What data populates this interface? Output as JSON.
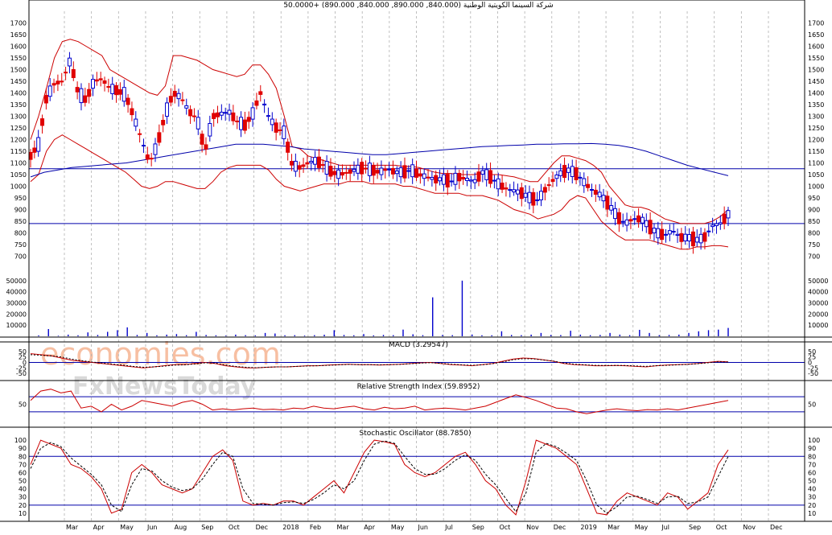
{
  "header": {
    "title": "شركة السينما الكويتية الوطنية (840.000, 890.000, 840.000, 890.000) +50.0000"
  },
  "watermark": {
    "line1": "economies.com",
    "line2": "FxNewsToday"
  },
  "colors": {
    "up_candle": "#0000cc",
    "down_candle": "#e00000",
    "bollinger": "#cc0000",
    "ma_long": "#0000aa",
    "hline": "#0000aa",
    "volume": "#0000cc",
    "macd": "#cc0000",
    "signal": "#000000",
    "rsi": "#cc0000",
    "stoch_k": "#cc0000",
    "stoch_d": "#000000",
    "grid": "#b0b0b0"
  },
  "x_axis": {
    "labels": [
      "Mar",
      "Apr",
      "May",
      "Jun",
      "Aug",
      "Sep",
      "Oct",
      "Dec",
      "2018",
      "Feb",
      "Mar",
      "Apr",
      "May",
      "Jun",
      "Jul",
      "Sep",
      "Oct",
      "Nov",
      "Dec",
      "2019",
      "Mar",
      "May",
      "Jul",
      "Sep",
      "Oct",
      "Nov",
      "Dec"
    ]
  },
  "chart_data": [
    {
      "type": "candlestick",
      "panel": "price",
      "title": "شركة السينما الكويتية الوطنية (840.000, 890.000, 840.000, 890.000) +50.0000",
      "ylim": [
        650,
        1750
      ],
      "yticks": [
        700,
        750,
        800,
        850,
        900,
        950,
        1000,
        1050,
        1100,
        1150,
        1200,
        1250,
        1300,
        1350,
        1400,
        1450,
        1500,
        1550,
        1600,
        1650,
        1700
      ],
      "horizontal_lines": [
        1075,
        840
      ],
      "price_path": [
        1130,
        1180,
        1380,
        1440,
        1450,
        1540,
        1400,
        1370,
        1450,
        1460,
        1420,
        1410,
        1390,
        1300,
        1200,
        1100,
        1180,
        1310,
        1400,
        1380,
        1320,
        1290,
        1150,
        1300,
        1310,
        1320,
        1280,
        1260,
        1310,
        1400,
        1300,
        1250,
        1230,
        1090,
        1080,
        1100,
        1110,
        1090,
        1060,
        1050,
        1060,
        1070,
        1080,
        1070,
        1060,
        1075,
        1060,
        1060,
        1070,
        1050,
        1040,
        1030,
        1030,
        1020,
        1040,
        1030,
        1020,
        1060,
        1040,
        1010,
        990,
        980,
        970,
        950,
        940,
        990,
        1030,
        1060,
        1070,
        1050,
        1010,
        980,
        960,
        920,
        870,
        840,
        860,
        860,
        830,
        800,
        790,
        810,
        780,
        780,
        770,
        780,
        830,
        840,
        880
      ],
      "bollinger_upper": [
        1200,
        1300,
        1420,
        1550,
        1620,
        1630,
        1620,
        1600,
        1580,
        1560,
        1500,
        1480,
        1460,
        1440,
        1420,
        1400,
        1390,
        1430,
        1560,
        1560,
        1550,
        1540,
        1520,
        1500,
        1490,
        1480,
        1470,
        1480,
        1520,
        1520,
        1480,
        1420,
        1300,
        1170,
        1160,
        1130,
        1120,
        1110,
        1100,
        1090,
        1090,
        1090,
        1090,
        1090,
        1090,
        1090,
        1090,
        1085,
        1085,
        1080,
        1070,
        1060,
        1055,
        1055,
        1050,
        1050,
        1050,
        1060,
        1050,
        1050,
        1045,
        1040,
        1030,
        1020,
        1020,
        1060,
        1100,
        1130,
        1130,
        1120,
        1110,
        1090,
        1060,
        1000,
        960,
        920,
        910,
        910,
        900,
        880,
        860,
        850,
        840,
        840,
        840,
        840,
        850,
        870,
        900
      ],
      "bollinger_lower": [
        1020,
        1050,
        1150,
        1200,
        1220,
        1200,
        1180,
        1160,
        1140,
        1120,
        1100,
        1080,
        1060,
        1030,
        1000,
        990,
        1000,
        1020,
        1020,
        1010,
        1000,
        990,
        990,
        1020,
        1060,
        1080,
        1090,
        1090,
        1090,
        1090,
        1070,
        1030,
        1000,
        990,
        980,
        990,
        1000,
        1010,
        1010,
        1010,
        1020,
        1020,
        1020,
        1010,
        1010,
        1010,
        1010,
        1000,
        1000,
        990,
        980,
        970,
        970,
        970,
        970,
        960,
        960,
        960,
        950,
        940,
        920,
        900,
        890,
        880,
        860,
        870,
        880,
        900,
        940,
        960,
        950,
        900,
        850,
        820,
        790,
        770,
        770,
        770,
        770,
        760,
        750,
        740,
        730,
        730,
        740,
        740,
        745,
        745,
        740
      ],
      "ma_long": [
        1040,
        1060,
        1070,
        1080,
        1085,
        1090,
        1095,
        1100,
        1110,
        1120,
        1130,
        1140,
        1150,
        1160,
        1170,
        1180,
        1180,
        1180,
        1175,
        1170,
        1160,
        1155,
        1150,
        1145,
        1140,
        1135,
        1135,
        1140,
        1145,
        1150,
        1155,
        1160,
        1165,
        1170,
        1172,
        1175,
        1177,
        1180,
        1180,
        1182,
        1182,
        1183,
        1180,
        1175,
        1165,
        1150,
        1130,
        1110,
        1090,
        1075,
        1060,
        1045
      ]
    },
    {
      "type": "bar",
      "panel": "volume",
      "ylim": [
        0,
        60000
      ],
      "yticks": [
        10000,
        20000,
        30000,
        40000,
        50000
      ],
      "values": [
        800,
        6500,
        500,
        1500,
        900,
        3500,
        1200,
        4000,
        5500,
        8000,
        1200,
        3000,
        900,
        1500,
        2000,
        1000,
        4000,
        1200,
        900,
        600,
        1500,
        1000,
        800,
        3000,
        2500,
        900,
        1000,
        600,
        1000,
        1400,
        5500,
        1200,
        900,
        2000,
        800,
        1200,
        1000,
        6000,
        1800,
        1000,
        35000,
        1200,
        1000,
        50000,
        1600,
        900,
        900,
        4500,
        1200,
        1000,
        1500,
        3000,
        1200,
        1100,
        5000,
        1500,
        1000,
        1200,
        3000,
        1500,
        1000,
        5800,
        3000,
        1000,
        1200,
        1500,
        3000,
        4500,
        5500,
        6000,
        7500
      ]
    },
    {
      "type": "line",
      "panel": "macd",
      "title": "MACD (3.29547)",
      "ylim": [
        -75,
        75
      ],
      "yticks": [
        -50,
        -25,
        0,
        25,
        50
      ],
      "series": [
        {
          "values": [
            40,
            35,
            30,
            20,
            10,
            5,
            0,
            -5,
            -10,
            -15,
            -20,
            -25,
            -20,
            -15,
            -10,
            -10,
            -5,
            0,
            -5,
            -15,
            -20,
            -25,
            -25,
            -22,
            -20,
            -20,
            -18,
            -15,
            -15,
            -12,
            -10,
            -8,
            -10,
            -10,
            -12,
            -10,
            -8,
            -5,
            -2,
            0,
            -5,
            -10,
            -12,
            -15,
            -10,
            -5,
            5,
            15,
            20,
            18,
            12,
            5,
            -5,
            -10,
            -12,
            -15,
            -15,
            -14,
            -15,
            -18,
            -20,
            -15,
            -12,
            -10,
            -8,
            -5,
            0,
            5,
            3
          ]
        },
        {
          "values": [
            35,
            33,
            30,
            25,
            15,
            8,
            2,
            -3,
            -8,
            -12,
            -18,
            -22,
            -20,
            -17,
            -12,
            -11,
            -7,
            -2,
            -3,
            -12,
            -18,
            -22,
            -24,
            -22,
            -20,
            -20,
            -18,
            -16,
            -15,
            -13,
            -11,
            -9,
            -10,
            -10,
            -11,
            -10,
            -9,
            -6,
            -3,
            -1,
            -4,
            -8,
            -11,
            -13,
            -11,
            -6,
            2,
            12,
            17,
            16,
            11,
            6,
            -3,
            -8,
            -11,
            -13,
            -14,
            -14,
            -14,
            -16,
            -18,
            -15,
            -13,
            -11,
            -9,
            -6,
            -2,
            3,
            2
          ]
        }
      ]
    },
    {
      "type": "line",
      "panel": "rsi",
      "title": "Relative Strength Index (59.8952)",
      "ylim": [
        0,
        100
      ],
      "yticks": [
        50
      ],
      "horizontal_lines": [
        70,
        30
      ],
      "series": [
        {
          "values": [
            60,
            85,
            90,
            80,
            85,
            40,
            45,
            30,
            50,
            35,
            45,
            60,
            55,
            50,
            45,
            55,
            60,
            50,
            35,
            38,
            35,
            38,
            40,
            36,
            37,
            35,
            40,
            38,
            45,
            40,
            38,
            42,
            45,
            38,
            35,
            42,
            38,
            40,
            45,
            35,
            38,
            40,
            38,
            35,
            40,
            45,
            55,
            65,
            75,
            68,
            60,
            50,
            40,
            38,
            30,
            25,
            30,
            35,
            38,
            35,
            33,
            36,
            35,
            38,
            35,
            40,
            45,
            50,
            55,
            60
          ]
        }
      ]
    },
    {
      "type": "line",
      "panel": "stochastic",
      "title": "Stochastic Oscillator (88.7850)",
      "ylim": [
        0,
        110
      ],
      "yticks": [
        10,
        20,
        30,
        40,
        50,
        60,
        70,
        80,
        90,
        100
      ],
      "horizontal_lines": [
        80,
        20
      ],
      "series": [
        {
          "values": [
            70,
            100,
            95,
            90,
            70,
            65,
            55,
            40,
            10,
            15,
            60,
            70,
            60,
            45,
            40,
            35,
            40,
            60,
            80,
            88,
            75,
            25,
            20,
            22,
            20,
            25,
            25,
            20,
            30,
            40,
            50,
            35,
            60,
            85,
            100,
            98,
            95,
            70,
            60,
            55,
            60,
            70,
            80,
            85,
            70,
            50,
            40,
            20,
            8,
            50,
            100,
            95,
            90,
            80,
            70,
            40,
            10,
            8,
            25,
            35,
            30,
            25,
            20,
            35,
            30,
            15,
            25,
            35,
            70,
            88
          ]
        },
        {
          "values": [
            65,
            90,
            97,
            92,
            78,
            68,
            58,
            45,
            20,
            12,
            45,
            65,
            62,
            50,
            42,
            38,
            40,
            52,
            70,
            85,
            80,
            40,
            22,
            21,
            20,
            23,
            24,
            22,
            27,
            35,
            45,
            40,
            50,
            75,
            95,
            99,
            96,
            80,
            65,
            58,
            58,
            65,
            75,
            82,
            75,
            58,
            45,
            28,
            12,
            35,
            85,
            96,
            92,
            84,
            75,
            50,
            20,
            10,
            18,
            30,
            31,
            27,
            22,
            30,
            31,
            22,
            24,
            30,
            55,
            80
          ]
        }
      ]
    }
  ]
}
